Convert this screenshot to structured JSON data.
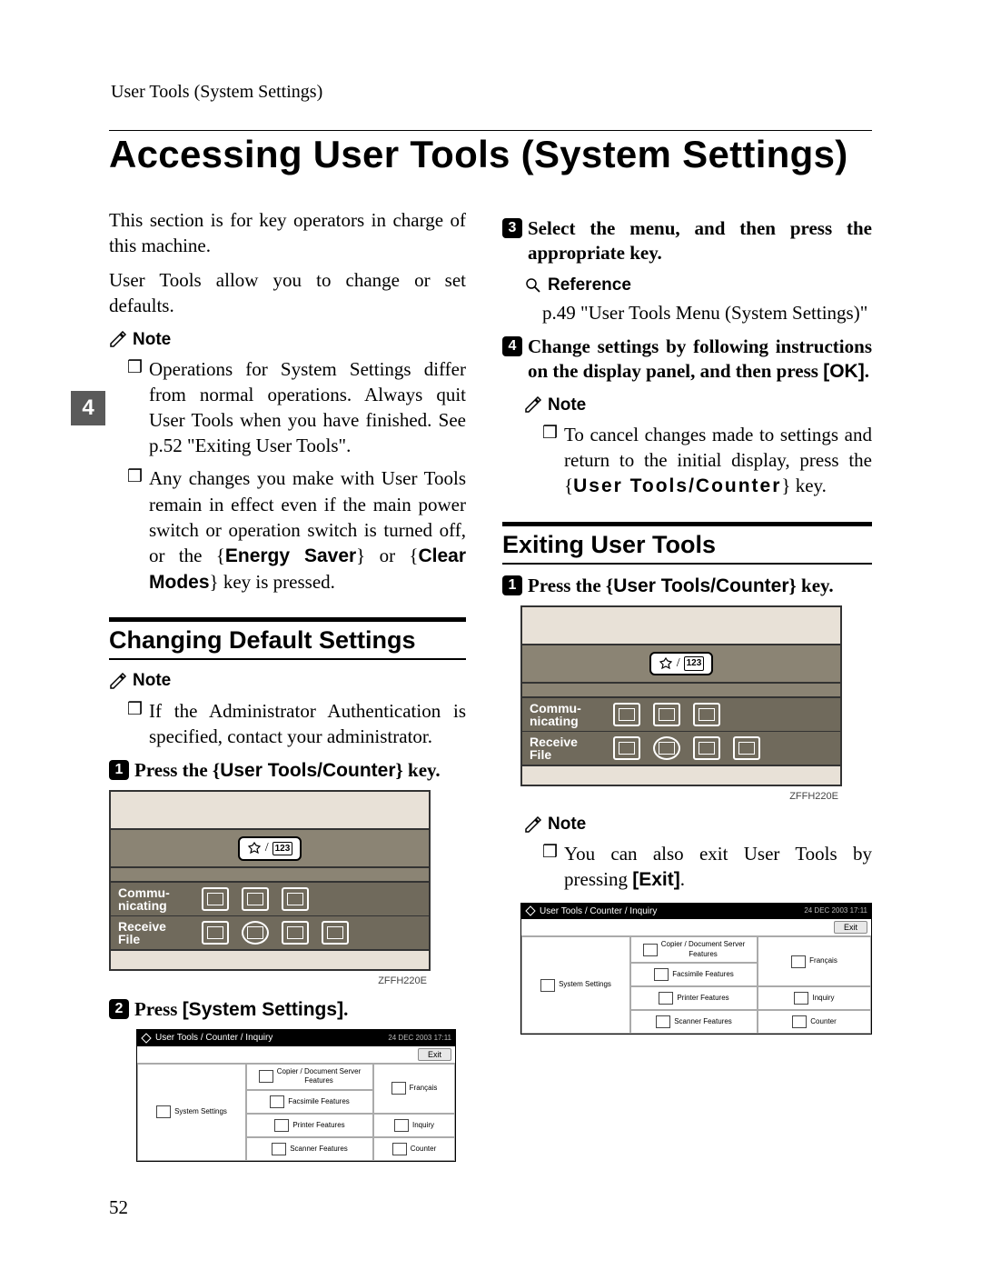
{
  "header": {
    "running": "User Tools (System Settings)"
  },
  "title": "Accessing User Tools (System Settings)",
  "tab_number": "4",
  "intro1": "This section is for key operators in charge of this machine.",
  "intro2": "User Tools allow you to change or set defaults.",
  "note_label": "Note",
  "reference_label": "Reference",
  "note1_items": [
    "Operations for System Settings differ from normal operations. Always quit User Tools when you have finished. See p.52 \"Exiting User Tools\".",
    "Any changes you make with User Tools remain in effect even if the main power switch or operation switch is turned off, or the {Energy Saver} or {Clear Modes} key is pressed."
  ],
  "section_changing": "Changing Default Settings",
  "note2_items": [
    "If the Administrator Authentication is specified, contact your administrator."
  ],
  "step1": "Press the {User Tools/Counter} key.",
  "step2": "Press [System Settings].",
  "step3": "Select the menu, and then press the appropriate key.",
  "reference_text": "p.49 \"User Tools Menu (System Settings)\"",
  "step4": "Change settings by following instructions on the display panel, and then press [OK].",
  "note3_items": [
    "To cancel changes made to settings and return to the initial display, press the {User Tools/Counter} key."
  ],
  "section_exiting": "Exiting User Tools",
  "step_e1": "Press the {User Tools/Counter} key.",
  "note4_items": [
    "You can also exit User Tools by pressing [Exit]."
  ],
  "panel": {
    "row1_label": "Commu-\nnicating",
    "row2_label": "Receive\nFile",
    "ut_marker": "123",
    "caption": "ZFFH220E"
  },
  "screen": {
    "title": "User Tools / Counter / Inquiry",
    "datetime": "24 DEC   2003 17:11",
    "exit": "Exit",
    "system_settings": "System Settings",
    "copier": "Copier / Document Server\nFeatures",
    "fax": "Facsimile Features",
    "printer": "Printer Features",
    "scanner": "Scanner Features",
    "francais": "Français",
    "inquiry": "Inquiry",
    "counter": "Counter"
  },
  "pagenum": "52"
}
